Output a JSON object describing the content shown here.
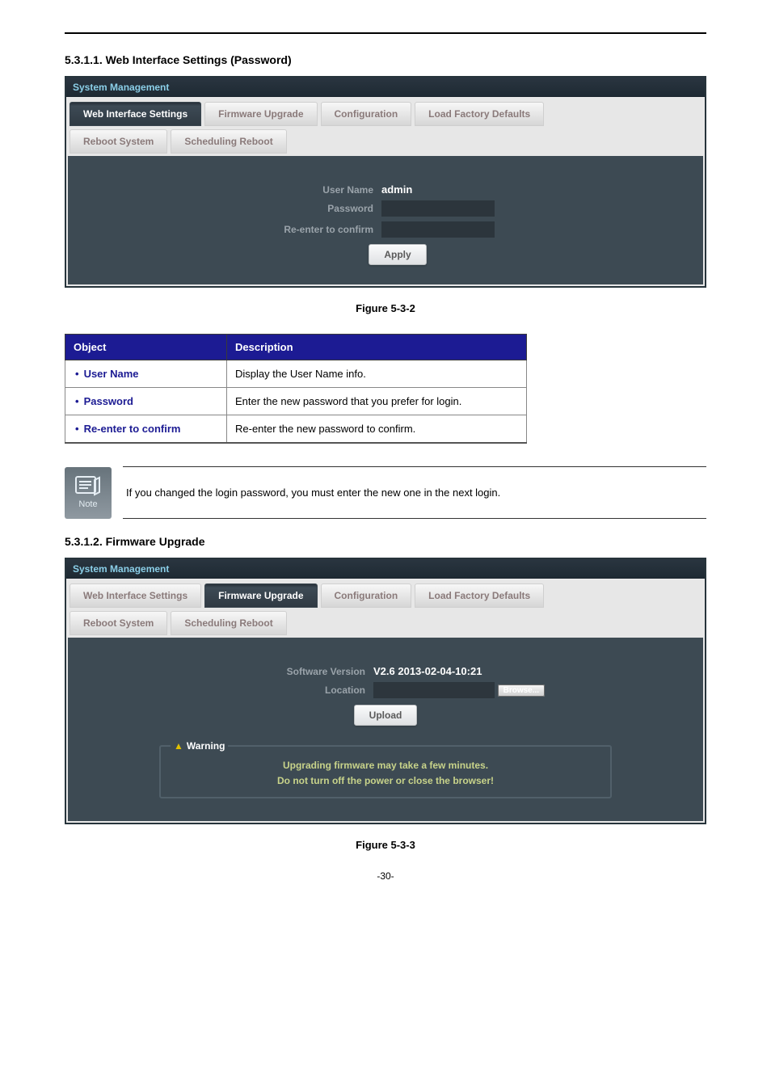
{
  "heading1": {
    "num": "5.3.1.1.",
    "title": "Web Interface Settings (Password)"
  },
  "panel1": {
    "title": "System Management",
    "tabs": [
      {
        "label": "Web Interface Settings",
        "active": true
      },
      {
        "label": "Firmware Upgrade"
      },
      {
        "label": "Configuration"
      },
      {
        "label": "Load Factory Defaults"
      },
      {
        "label": "Reboot System"
      },
      {
        "label": "Scheduling Reboot"
      }
    ],
    "form": {
      "user_name_label": "User Name",
      "user_name_value": "admin",
      "password_label": "Password",
      "confirm_label": "Re-enter to confirm",
      "apply_label": "Apply"
    }
  },
  "figure1": "Figure 5-3-2",
  "table": {
    "headers": {
      "object": "Object",
      "desc": "Description"
    },
    "rows": [
      {
        "obj": "User Name",
        "desc": "Display the User Name info."
      },
      {
        "obj": "Password",
        "desc": "Enter the new password that you prefer for login."
      },
      {
        "obj": "Re-enter to confirm",
        "desc": "Re-enter the new password to confirm."
      }
    ]
  },
  "note": {
    "label": "Note",
    "text": "If you changed the login password, you must enter the new one in the next login."
  },
  "heading2": {
    "num": "5.3.1.2.",
    "title": "Firmware Upgrade"
  },
  "panel2": {
    "title": "System Management",
    "tabs": [
      {
        "label": "Web Interface Settings"
      },
      {
        "label": "Firmware Upgrade",
        "active": true
      },
      {
        "label": "Configuration"
      },
      {
        "label": "Load Factory Defaults"
      },
      {
        "label": "Reboot System"
      },
      {
        "label": "Scheduling Reboot"
      }
    ],
    "form": {
      "version_label": "Software Version",
      "version_value": "V2.6 2013-02-04-10:21",
      "location_label": "Location",
      "browse_label": "Browse...",
      "upload_label": "Upload"
    },
    "warning": {
      "legend": "Warning",
      "line1": "Upgrading firmware may take a few minutes.",
      "line2": "Do not turn off the power or close the browser!"
    }
  },
  "figure2": "Figure 5-3-3",
  "pagenum": "-30-"
}
